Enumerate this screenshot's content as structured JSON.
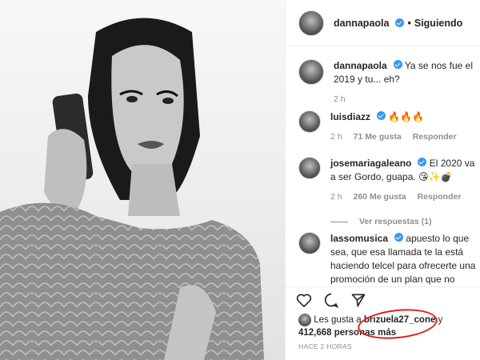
{
  "post": {
    "username": "dannapaola",
    "following_label": "Siguiendo"
  },
  "comments": [
    {
      "username": "dannapaola",
      "text": "Ya se nos fue el 2019 y tu... eh?",
      "time": "2 h"
    },
    {
      "username": "luisdiazz",
      "text": "🔥🔥🔥",
      "time": "2 h",
      "likes": "71 Me gusta",
      "reply_label": "Responder"
    },
    {
      "username": "josemariagaleano",
      "text": "El 2020 va a ser Gordo, guapa. 😘✨💣",
      "time": "2 h",
      "likes": "260 Me gusta",
      "reply_label": "Responder",
      "view_replies": "Ver respuestas (1)"
    },
    {
      "username": "lassomusica",
      "text": "apuesto lo que sea, que esa llamada te la está haciendo telcel para ofrecerte una promoción de un plan que no"
    }
  ],
  "likes_line": {
    "prefix": "Les gusta a",
    "user": "brizuela27_cone",
    "connector": "y",
    "count": "412,668 personas más"
  },
  "timestamp": "HACE 2 HORAS",
  "colors": {
    "verified": "#3897f0",
    "annotation_ring": "#e0201b",
    "muted": "#8e8e8e"
  }
}
